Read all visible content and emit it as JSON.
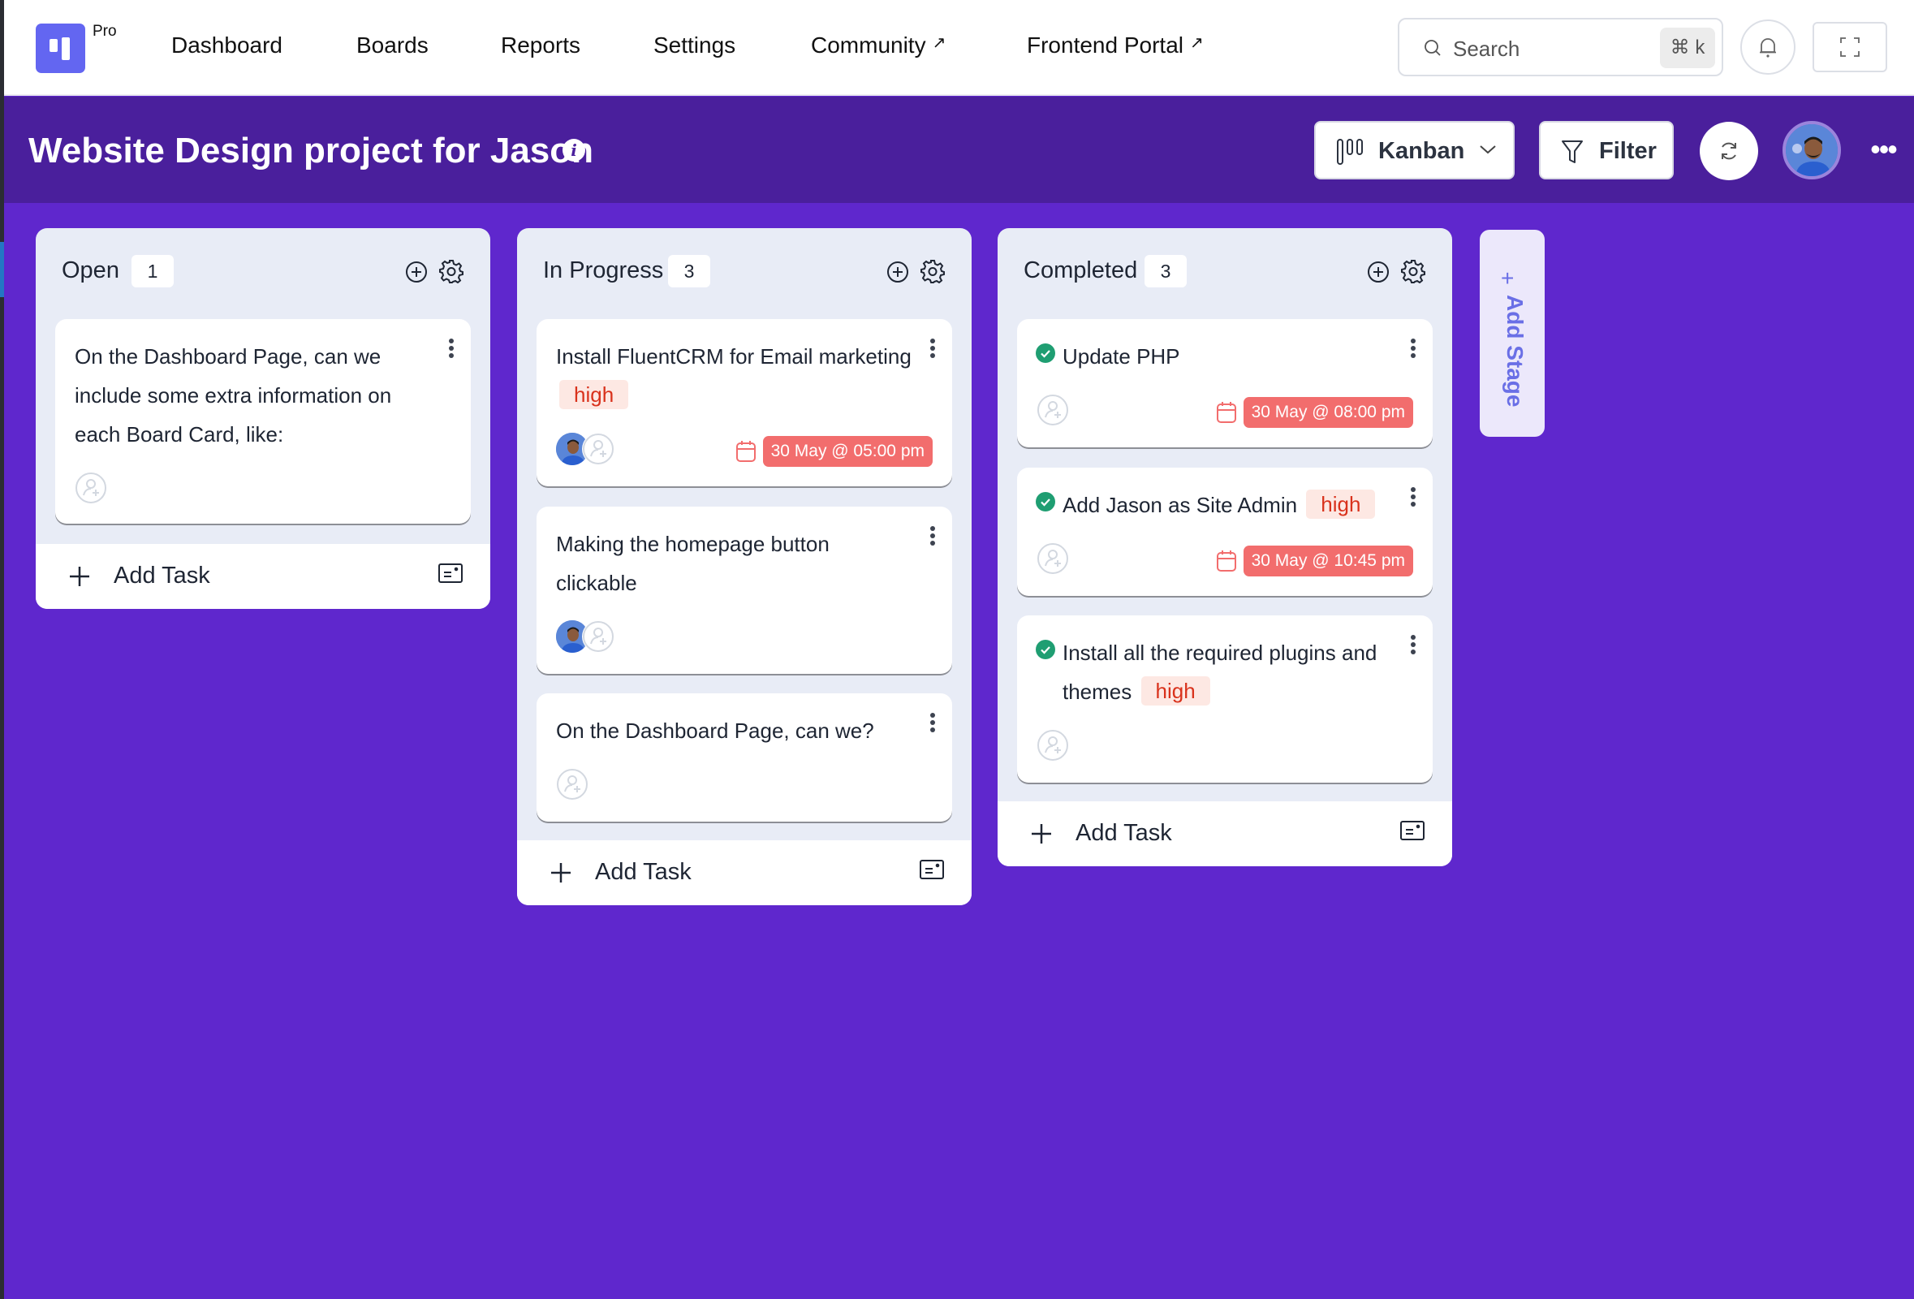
{
  "app": {
    "plan_badge": "Pro",
    "brand_color": "#6366f1"
  },
  "nav": {
    "links": [
      {
        "label": "Dashboard",
        "external": false
      },
      {
        "label": "Boards",
        "external": false
      },
      {
        "label": "Reports",
        "external": false
      },
      {
        "label": "Settings",
        "external": false
      },
      {
        "label": "Community",
        "external": true
      },
      {
        "label": "Frontend Portal",
        "external": true
      }
    ],
    "external_glyph": "↗",
    "search": {
      "placeholder": "Search",
      "shortcut": "⌘ k"
    },
    "icons": {
      "search": "search-icon",
      "notifications": "bell-icon",
      "fullscreen": "fullscreen-icon"
    }
  },
  "board": {
    "title": "Website Design project for Jason",
    "view_selector": {
      "label": "Kanban",
      "icon": "kanban-icon"
    },
    "filter_label": "Filter",
    "more_glyph": "•••",
    "colors": {
      "header_bg": "#4a1f9c",
      "board_bg": "#5f27cd",
      "column_bg": "#e8ecf6",
      "due_badge": "#f26d6d",
      "priority_text": "#d9321c",
      "priority_bg": "#fde8e3",
      "complete_check": "#1f9e72"
    }
  },
  "columns": [
    {
      "title": "Open",
      "count": "1",
      "add_task_label": "Add Task",
      "tasks": [
        {
          "title": "On the Dashboard Page, can we include some extra information on each Board Card, like:",
          "priority": null,
          "completed": false,
          "assignees": [],
          "due": null
        }
      ]
    },
    {
      "title": "In Progress",
      "count": "3",
      "add_task_label": "Add Task",
      "tasks": [
        {
          "title": "Install FluentCRM for Email marketing",
          "priority": "high",
          "completed": false,
          "assignees": [
            "user-avatar"
          ],
          "due": "30 May @ 05:00 pm"
        },
        {
          "title": "Making the homepage button clickable",
          "priority": null,
          "completed": false,
          "assignees": [
            "user-avatar"
          ],
          "due": null
        },
        {
          "title": "On the Dashboard Page, can we?",
          "priority": null,
          "completed": false,
          "assignees": [],
          "due": null
        }
      ]
    },
    {
      "title": "Completed",
      "count": "3",
      "add_task_label": "Add Task",
      "tasks": [
        {
          "title": "Update PHP",
          "priority": null,
          "completed": true,
          "assignees": [],
          "due": "30 May @ 08:00 pm"
        },
        {
          "title": "Add Jason as Site Admin",
          "priority": "high",
          "completed": true,
          "assignees": [],
          "due": "30 May @ 10:45 pm"
        },
        {
          "title": "Install all the required plugins and themes",
          "priority": "high",
          "completed": true,
          "assignees": [],
          "due": null
        }
      ]
    }
  ],
  "add_stage": {
    "plus": "+",
    "label": "Add Stage"
  }
}
